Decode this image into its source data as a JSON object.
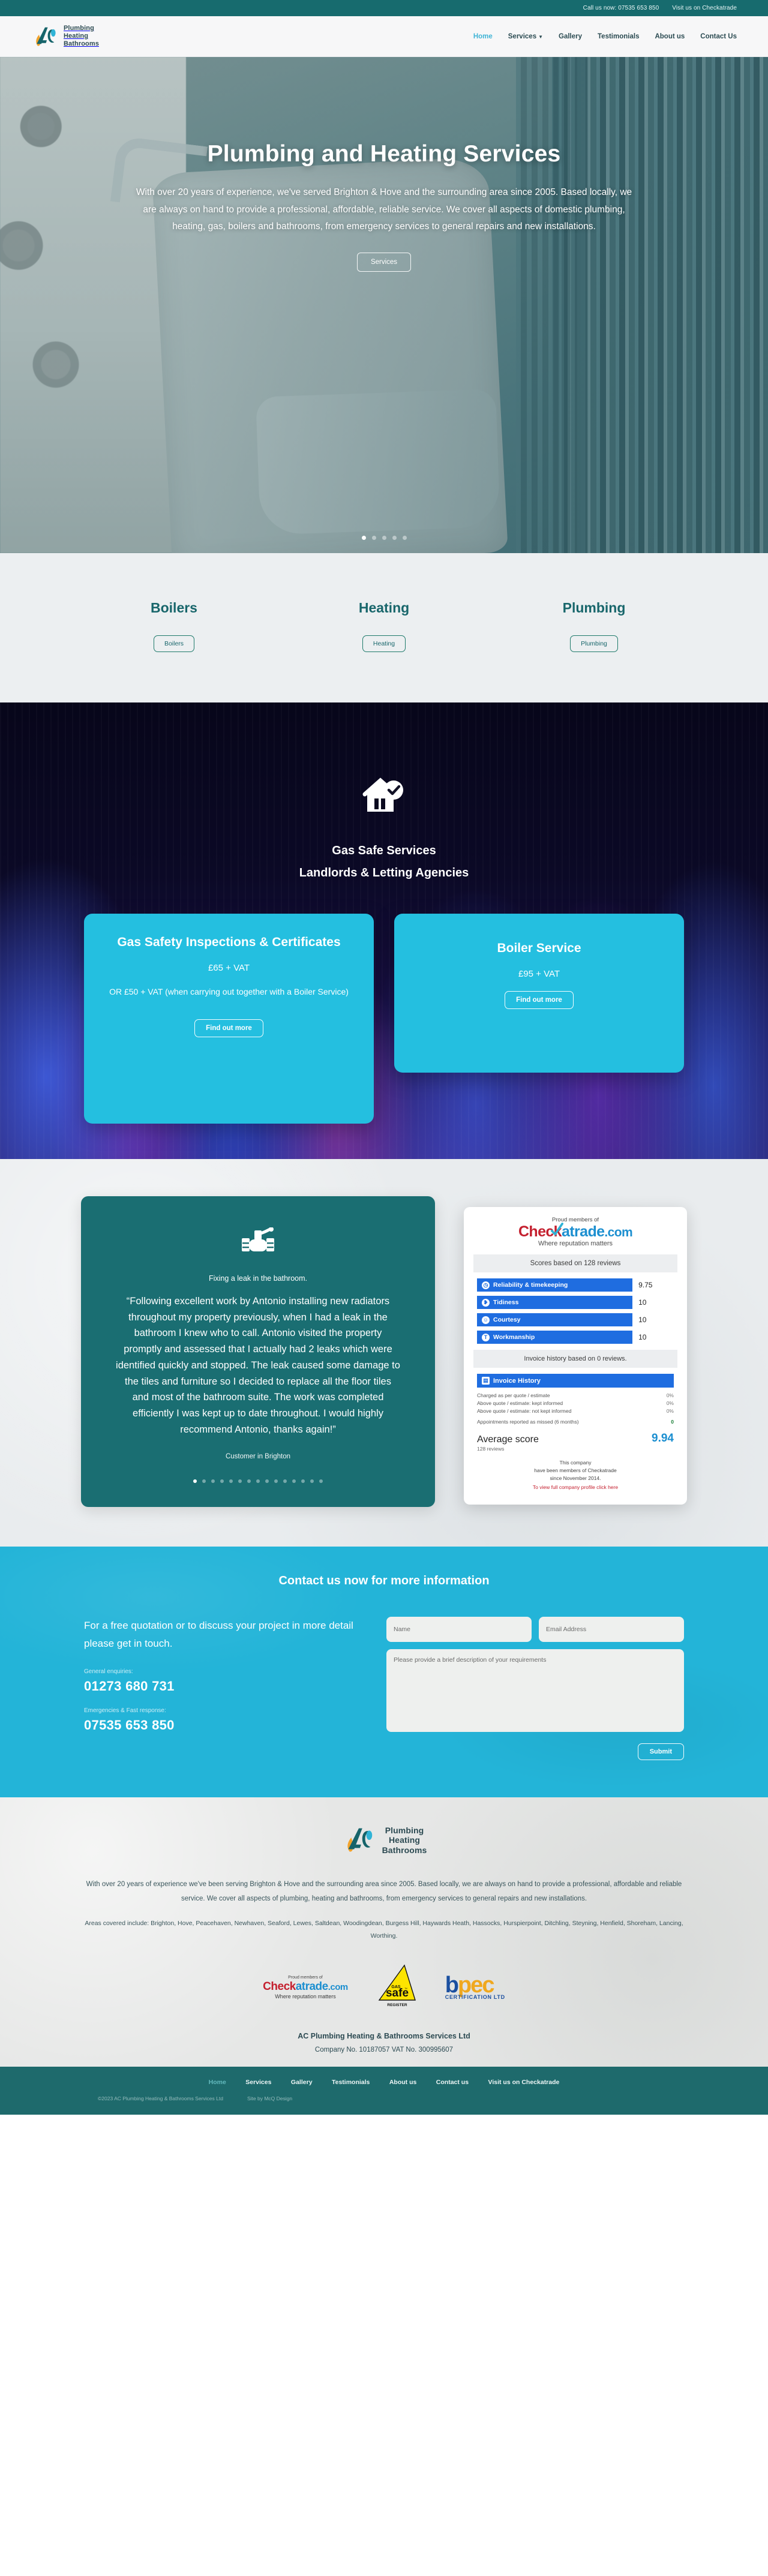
{
  "topbar": {
    "phone": "Call us now: 07535 653 850",
    "checkatrade": "Visit us on Checkatrade"
  },
  "brand": {
    "line1": "Plumbing",
    "line2": "Heating",
    "line3": "Bathrooms"
  },
  "nav": {
    "home": "Home",
    "services": "Services",
    "gallery": "Gallery",
    "testimonials": "Testimonials",
    "about": "About us",
    "contact": "Contact Us"
  },
  "hero": {
    "title": "Plumbing and Heating Services",
    "subtitle": "With over 20 years of experience, we've served Brighton & Hove and the surrounding area since 2005. Based locally, we are always on hand to provide a professional, affordable, reliable service. We cover all aspects of domestic plumbing, heating, gas, boilers and bathrooms, from emergency services to general repairs and new installations.",
    "button": "Services",
    "slides": 5,
    "active_slide": 1
  },
  "services": [
    {
      "title": "Boilers",
      "button": "Boilers"
    },
    {
      "title": "Heating",
      "button": "Heating"
    },
    {
      "title": "Plumbing",
      "button": "Plumbing"
    }
  ],
  "gas": {
    "icon": "house-check-icon",
    "heading1": "Gas Safe Services",
    "heading2": "Landlords & Letting Agencies",
    "cards": [
      {
        "title": "Gas Safety Inspections & Certificates",
        "price": "£65 + VAT",
        "note": "OR £50 + VAT (when carrying out together with a Boiler Service)",
        "button": "Find out more"
      },
      {
        "title": "Boiler Service",
        "price": "£95 + VAT",
        "note": "",
        "button": "Find out more"
      }
    ]
  },
  "testimonial": {
    "icon": "valve-icon",
    "caption": "Fixing a leak in the bathroom.",
    "quote": "“Following excellent work by Antonio installing new radiators throughout my property previously, when I had a leak in the bathroom I knew who to call. Antonio visited the property promptly and assessed that I actually had 2 leaks which were identified quickly and stopped. The leak caused some damage to the tiles and furniture so I decided to replace all the floor tiles and most of the bathroom suite. The work was completed efficiently I was kept up to date throughout. I would highly recommend Antonio, thanks again!”",
    "author": "Customer in Brighton",
    "dots": 15,
    "active_dot": 1
  },
  "checkatrade": {
    "proud": "Proud members of",
    "logo_check": "Check",
    "logo_atrade": "atrade",
    "logo_com": ".com",
    "tagline": "Where reputation matters",
    "scores_header": "Scores based on 128 reviews",
    "scores": [
      {
        "label": "Reliability & timekeeping",
        "value": "9.75",
        "icon": "clock-icon"
      },
      {
        "label": "Tidiness",
        "value": "10",
        "icon": "broom-icon"
      },
      {
        "label": "Courtesy",
        "value": "10",
        "icon": "smile-icon"
      },
      {
        "label": "Workmanship",
        "value": "10",
        "icon": "tools-icon"
      }
    ],
    "invoice_note": "Invoice history based on 0 reviews.",
    "invoice_header": "Invoice History",
    "invoice_rows": [
      {
        "label": "Charged as per quote / estimate",
        "value": "0%"
      },
      {
        "label": "Above quote / estimate: kept informed",
        "value": "0%"
      },
      {
        "label": "Above quote / estimate: not kept informed",
        "value": "0%"
      }
    ],
    "missed_label": "Appointments reported as missed (6 months)",
    "missed_value": "0",
    "average_label": "Average score",
    "average_value": "9.94",
    "review_count": "128 reviews",
    "member_line1": "This company",
    "member_line2": "have been members of Checkatrade",
    "member_line3": "since November 2014.",
    "profile_link": "To view full company profile click here"
  },
  "contact": {
    "heading": "Contact us now for more information",
    "lead": "For a free quotation or to discuss your project in more detail please get in touch.",
    "general_label": "General enquiries:",
    "general_number": "01273 680 731",
    "emergency_label": "Emergencies & Fast response:",
    "emergency_number": "07535 653 850",
    "name_placeholder": "Name",
    "email_placeholder": "Email Address",
    "message_placeholder": "Please provide a brief description of your requirements",
    "submit": "Submit"
  },
  "footer": {
    "copy": "With over 20 years of experience we've been serving Brighton & Hove and the surrounding area since 2005. Based locally, we are always on hand to provide a professional, affordable and reliable service. We cover all aspects of plumbing, heating and bathrooms, from emergency services to general repairs and new installations.",
    "areas": "Areas covered include: Brighton, Hove, Peacehaven, Newhaven, Seaford, Lewes, Saltdean, Woodingdean, Burgess Hill, Haywards Heath, Hassocks, Hurspierpoint, Ditchling, Steyning, Henfield, Shoreham, Lancing, Worthing.",
    "badges": {
      "checkatrade_proud": "Proud members of",
      "checkatrade_check": "Check",
      "checkatrade_atrade": "atrade",
      "checkatrade_com": ".com",
      "checkatrade_tagline": "Where reputation matters",
      "gassafe_top": "GAS",
      "gassafe_main": "safe",
      "gassafe_bottom": "REGISTER",
      "bpec_name": "bpec",
      "bpec_sub": "CERTIFICATION LTD"
    },
    "company_name": "AC Plumbing Heating & Bathrooms Services Ltd",
    "company_numbers": "Company No. 10187057  VAT No. 300995607",
    "nav": {
      "home": "Home",
      "services": "Services",
      "gallery": "Gallery",
      "testimonials": "Testimonials",
      "about": "About us",
      "contact": "Contact us",
      "checkatrade": "Visit us on Checkatrade"
    },
    "copyright": "©2023 AC Plumbing Heating & Bathrooms Services Ltd",
    "credit": "Site by McQ Design"
  }
}
